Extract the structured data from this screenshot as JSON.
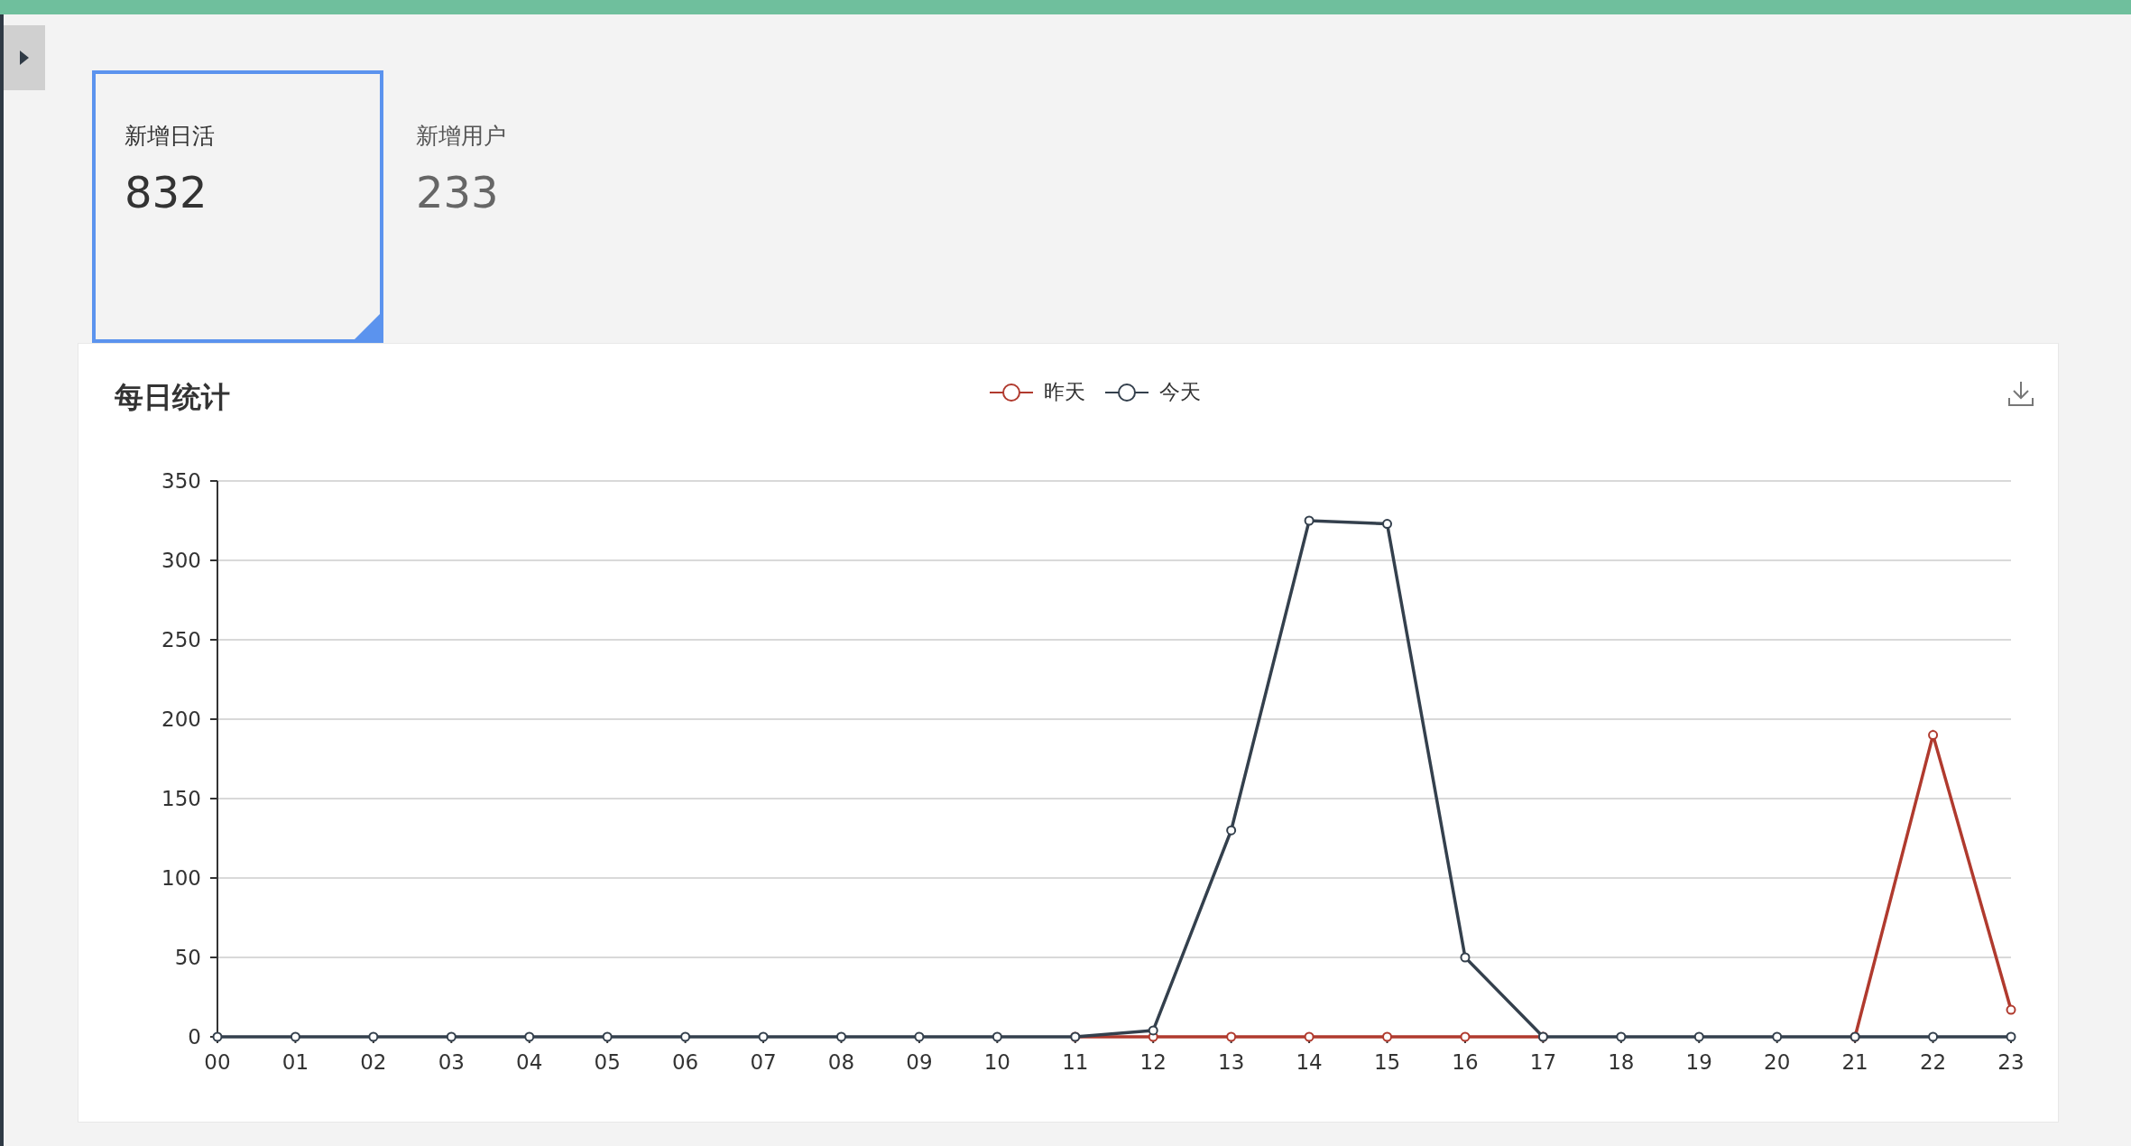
{
  "stats": [
    {
      "label": "新增日活",
      "value": "832",
      "selected": true
    },
    {
      "label": "新增用户",
      "value": "233",
      "selected": false
    }
  ],
  "panel": {
    "title": "每日统计",
    "chart_data": {
      "type": "line",
      "categories": [
        "00",
        "01",
        "02",
        "03",
        "04",
        "05",
        "06",
        "07",
        "08",
        "09",
        "10",
        "11",
        "12",
        "13",
        "14",
        "15",
        "16",
        "17",
        "18",
        "19",
        "20",
        "21",
        "22",
        "23"
      ],
      "grid": true,
      "series": [
        {
          "name": "昨天",
          "color": "#b03a2e",
          "marker": "circle",
          "values": [
            null,
            null,
            null,
            null,
            null,
            null,
            null,
            null,
            null,
            null,
            null,
            0,
            0,
            0,
            0,
            0,
            0,
            0,
            null,
            null,
            null,
            0,
            190,
            17
          ]
        },
        {
          "name": "今天",
          "color": "#34404d",
          "marker": "circle",
          "values": [
            0,
            0,
            0,
            0,
            0,
            0,
            0,
            0,
            0,
            0,
            0,
            0,
            4,
            130,
            325,
            323,
            50,
            0,
            0,
            0,
            0,
            0,
            0,
            0
          ]
        }
      ],
      "ylim": [
        0,
        350
      ],
      "yticks": [
        0,
        50,
        100,
        150,
        200,
        250,
        300,
        350
      ]
    }
  }
}
